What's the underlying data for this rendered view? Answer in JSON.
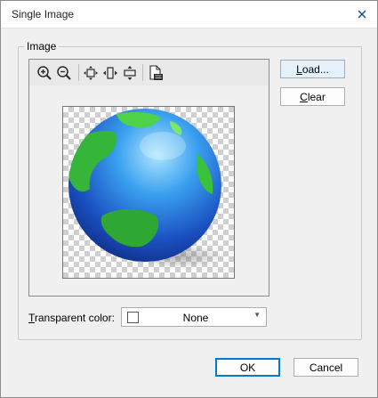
{
  "window": {
    "title": "Single Image"
  },
  "group": {
    "label": "Image"
  },
  "buttons": {
    "load_pre": "",
    "load_u": "L",
    "load_post": "oad...",
    "clear_pre": "",
    "clear_u": "C",
    "clear_post": "lear",
    "ok": "OK",
    "cancel": "Cancel"
  },
  "toolbar": {
    "items": [
      "zoom-in-icon",
      "zoom-out-icon",
      "fit-icon",
      "fit-width-icon",
      "fit-height-icon",
      "actual-size-icon"
    ]
  },
  "transparent_color": {
    "label_u": "T",
    "label_post": "ransparent color:",
    "value": "None",
    "swatch_color": "#ffffff"
  },
  "image": {
    "subject": "globe-image"
  },
  "colors": {
    "accent": "#0078d7",
    "globe_ocean": "#1e6fd6",
    "globe_land": "#3cc13a"
  }
}
